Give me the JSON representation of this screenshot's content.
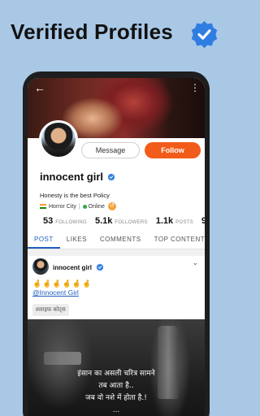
{
  "banner": {
    "title": "Verified Profiles"
  },
  "colors": {
    "accent": "#f25c1a",
    "link": "#1f5fbf",
    "verified": "#2f7de1",
    "background": "#a9c8e6"
  },
  "profile": {
    "name": "innocent girl",
    "bio": "Honesty is the best Policy",
    "location": "Horror City",
    "status": "Online",
    "message_label": "Message",
    "follow_label": "Follow"
  },
  "stats": [
    {
      "value": "53",
      "label": "FOLLOWING"
    },
    {
      "value": "5.1k",
      "label": "FOLLOWERS"
    },
    {
      "value": "1.1k",
      "label": "POSTS"
    },
    {
      "value": "9",
      "label": ""
    }
  ],
  "tabs": [
    "POST",
    "LIKES",
    "COMMENTS",
    "TOP CONTENT"
  ],
  "post": {
    "author": "innocent girl",
    "emojis": "🤞🤞🤞🤞🤞🤞",
    "mention": "@Innocent Girl",
    "tag": "#लाइफ कोट्स",
    "quote_lines": [
      "इंसान का असली चरित्र सामने",
      "तब आता है..",
      "जब वो नशे में होता है.!",
      "..."
    ]
  },
  "icons": [
    "back-arrow-icon",
    "more-vert-icon",
    "verified-badge-icon",
    "share-icon",
    "chevron-down-icon"
  ]
}
